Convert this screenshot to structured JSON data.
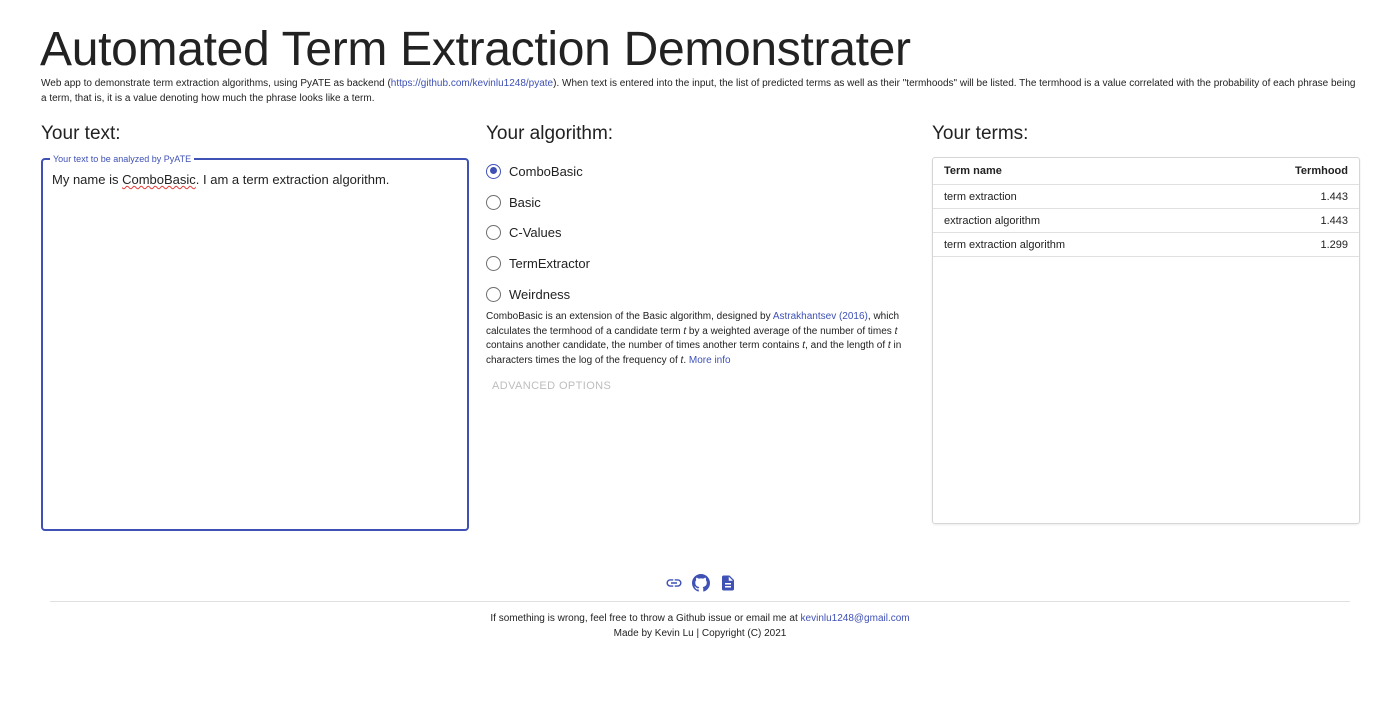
{
  "header": {
    "title": "Automated Term Extraction Demonstrater",
    "intro_before": "Web app to demonstrate term extraction algorithms, using PyATE as backend (",
    "intro_link": "https://github.com/kevinlu1248/pyate",
    "intro_after": "). When text is entered into the input, the list of predicted terms as well as their \"termhoods\" will be listed. The termhood is a value correlated with the probability of each phrase being a term, that is, it is a value denoting how much the phrase looks like a term."
  },
  "input_section": {
    "title": "Your text:",
    "field_label": "Your text to be analyzed by PyATE",
    "value_before": "My name is ",
    "value_misspelled": "ComboBasic",
    "value_after": ". I am a term extraction algorithm."
  },
  "algorithm_section": {
    "title": "Your algorithm:",
    "options": [
      {
        "label": "ComboBasic",
        "checked": true
      },
      {
        "label": "Basic",
        "checked": false
      },
      {
        "label": "C-Values",
        "checked": false
      },
      {
        "label": "TermExtractor",
        "checked": false
      },
      {
        "label": "Weirdness",
        "checked": false
      }
    ],
    "description": {
      "p1": "ComboBasic is an extension of the Basic algorithm, designed by ",
      "cite": "Astrakhantsev (2016)",
      "p2": ", which calculates the termhood of a candidate term ",
      "t1": "t",
      "p3": " by a weighted average of the number of times ",
      "t2": "t",
      "p4": " contains another candidate, the number of times another term contains ",
      "t3": "t",
      "p5": ", and the length of ",
      "t4": "t",
      "p6": " in characters times the log of the frequency of ",
      "t5": "t",
      "p7": ". ",
      "more": "More info"
    },
    "advanced_label": "ADVANCED OPTIONS"
  },
  "terms_section": {
    "title": "Your terms:",
    "columns": [
      "Term name",
      "Termhood"
    ],
    "rows": [
      {
        "term": "term extraction",
        "termhood": "1.443"
      },
      {
        "term": "extraction algorithm",
        "termhood": "1.443"
      },
      {
        "term": "term extraction algorithm",
        "termhood": "1.299"
      }
    ]
  },
  "footer": {
    "icons": [
      "link-icon",
      "github-icon",
      "document-icon"
    ],
    "line1_before": "If something is wrong, feel free to throw a Github issue or email me at ",
    "email": "kevinlu1248@gmail.com",
    "line2": "Made by Kevin Lu | Copyright (C) 2021"
  },
  "colors": {
    "accent": "#3f51b5",
    "disabled": "#bdbdbd",
    "border": "#d6d6d6"
  }
}
